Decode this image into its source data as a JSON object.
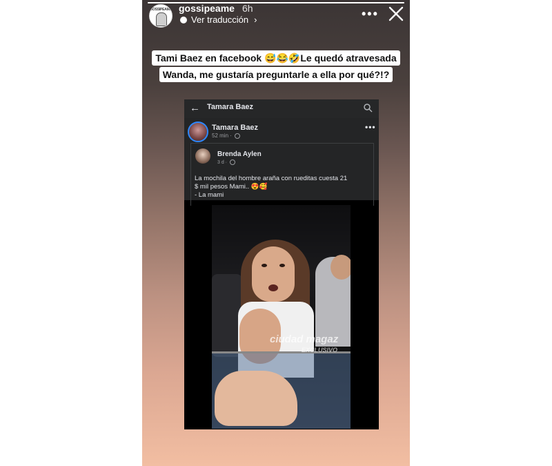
{
  "story": {
    "username": "gossipeame",
    "time": "6h",
    "translate_label": "Ver traducción",
    "avatar_text": "GOSSIPEAME",
    "progress": 1.0,
    "caption": {
      "line1": "Tami Baez en facebook 😅😂🤣Le quedó atravesada",
      "line2": "Wanda, me gustaría preguntarle a ella por qué?!?"
    }
  },
  "facebook": {
    "header_title": "Tamara Baez",
    "post": {
      "author": "Tamara Baez",
      "time": "52 min ·"
    },
    "shared": {
      "author": "Brenda Aylen",
      "time": "3 d ·",
      "text_line1": "La mochila del hombre araña con rueditas cuesta 21",
      "text_line2": "$ mil pesos Mami.. 😍🥰",
      "text_line3": "- La mami"
    },
    "video_watermark": "ciudad magaz",
    "video_watermark_sub": "EXCLUSIVO"
  }
}
